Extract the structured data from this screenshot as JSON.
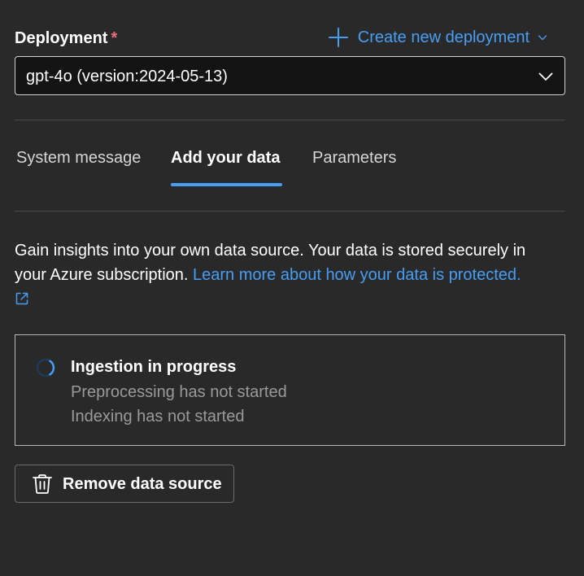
{
  "deployment": {
    "label": "Deployment",
    "required_marker": "*",
    "create_link_label": "Create new deployment",
    "selected_value": "gpt-4o (version:2024-05-13)"
  },
  "tabs": [
    {
      "label": "System message",
      "active": false
    },
    {
      "label": "Add your data",
      "active": true
    },
    {
      "label": "Parameters",
      "active": false
    }
  ],
  "info": {
    "text": "Gain insights into your own data source. Your data is stored securely in your Azure subscription.",
    "link_label": "Learn more about how your data is protected."
  },
  "ingestion": {
    "title": "Ingestion in progress",
    "preprocessing_status": "Preprocessing has not started",
    "indexing_status": "Indexing has not started"
  },
  "actions": {
    "remove_label": "Remove data source"
  },
  "icons": {
    "plus": "plus-icon",
    "chevron": "chevron-down-icon",
    "external": "external-link-icon",
    "spinner": "spinner-icon",
    "trash": "trash-icon"
  },
  "colors": {
    "background": "#292929",
    "accent": "#479ef5",
    "required": "#f1707b",
    "muted_text": "#9a9a9a"
  }
}
